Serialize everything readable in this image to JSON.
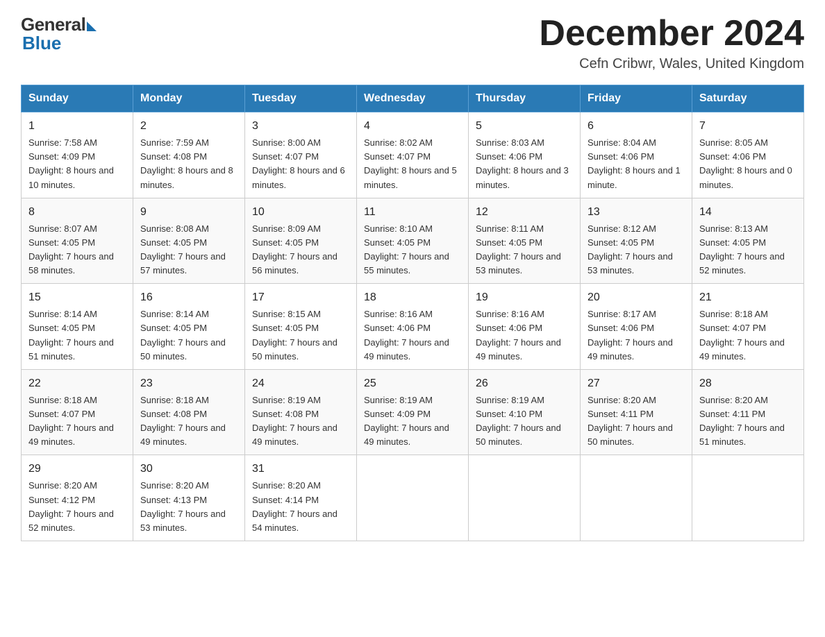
{
  "header": {
    "logo_general": "General",
    "logo_blue": "Blue",
    "month_title": "December 2024",
    "location": "Cefn Cribwr, Wales, United Kingdom"
  },
  "weekdays": [
    "Sunday",
    "Monday",
    "Tuesday",
    "Wednesday",
    "Thursday",
    "Friday",
    "Saturday"
  ],
  "weeks": [
    [
      {
        "day": "1",
        "sunrise": "7:58 AM",
        "sunset": "4:09 PM",
        "daylight": "8 hours and 10 minutes."
      },
      {
        "day": "2",
        "sunrise": "7:59 AM",
        "sunset": "4:08 PM",
        "daylight": "8 hours and 8 minutes."
      },
      {
        "day": "3",
        "sunrise": "8:00 AM",
        "sunset": "4:07 PM",
        "daylight": "8 hours and 6 minutes."
      },
      {
        "day": "4",
        "sunrise": "8:02 AM",
        "sunset": "4:07 PM",
        "daylight": "8 hours and 5 minutes."
      },
      {
        "day": "5",
        "sunrise": "8:03 AM",
        "sunset": "4:06 PM",
        "daylight": "8 hours and 3 minutes."
      },
      {
        "day": "6",
        "sunrise": "8:04 AM",
        "sunset": "4:06 PM",
        "daylight": "8 hours and 1 minute."
      },
      {
        "day": "7",
        "sunrise": "8:05 AM",
        "sunset": "4:06 PM",
        "daylight": "8 hours and 0 minutes."
      }
    ],
    [
      {
        "day": "8",
        "sunrise": "8:07 AM",
        "sunset": "4:05 PM",
        "daylight": "7 hours and 58 minutes."
      },
      {
        "day": "9",
        "sunrise": "8:08 AM",
        "sunset": "4:05 PM",
        "daylight": "7 hours and 57 minutes."
      },
      {
        "day": "10",
        "sunrise": "8:09 AM",
        "sunset": "4:05 PM",
        "daylight": "7 hours and 56 minutes."
      },
      {
        "day": "11",
        "sunrise": "8:10 AM",
        "sunset": "4:05 PM",
        "daylight": "7 hours and 55 minutes."
      },
      {
        "day": "12",
        "sunrise": "8:11 AM",
        "sunset": "4:05 PM",
        "daylight": "7 hours and 53 minutes."
      },
      {
        "day": "13",
        "sunrise": "8:12 AM",
        "sunset": "4:05 PM",
        "daylight": "7 hours and 53 minutes."
      },
      {
        "day": "14",
        "sunrise": "8:13 AM",
        "sunset": "4:05 PM",
        "daylight": "7 hours and 52 minutes."
      }
    ],
    [
      {
        "day": "15",
        "sunrise": "8:14 AM",
        "sunset": "4:05 PM",
        "daylight": "7 hours and 51 minutes."
      },
      {
        "day": "16",
        "sunrise": "8:14 AM",
        "sunset": "4:05 PM",
        "daylight": "7 hours and 50 minutes."
      },
      {
        "day": "17",
        "sunrise": "8:15 AM",
        "sunset": "4:05 PM",
        "daylight": "7 hours and 50 minutes."
      },
      {
        "day": "18",
        "sunrise": "8:16 AM",
        "sunset": "4:06 PM",
        "daylight": "7 hours and 49 minutes."
      },
      {
        "day": "19",
        "sunrise": "8:16 AM",
        "sunset": "4:06 PM",
        "daylight": "7 hours and 49 minutes."
      },
      {
        "day": "20",
        "sunrise": "8:17 AM",
        "sunset": "4:06 PM",
        "daylight": "7 hours and 49 minutes."
      },
      {
        "day": "21",
        "sunrise": "8:18 AM",
        "sunset": "4:07 PM",
        "daylight": "7 hours and 49 minutes."
      }
    ],
    [
      {
        "day": "22",
        "sunrise": "8:18 AM",
        "sunset": "4:07 PM",
        "daylight": "7 hours and 49 minutes."
      },
      {
        "day": "23",
        "sunrise": "8:18 AM",
        "sunset": "4:08 PM",
        "daylight": "7 hours and 49 minutes."
      },
      {
        "day": "24",
        "sunrise": "8:19 AM",
        "sunset": "4:08 PM",
        "daylight": "7 hours and 49 minutes."
      },
      {
        "day": "25",
        "sunrise": "8:19 AM",
        "sunset": "4:09 PM",
        "daylight": "7 hours and 49 minutes."
      },
      {
        "day": "26",
        "sunrise": "8:19 AM",
        "sunset": "4:10 PM",
        "daylight": "7 hours and 50 minutes."
      },
      {
        "day": "27",
        "sunrise": "8:20 AM",
        "sunset": "4:11 PM",
        "daylight": "7 hours and 50 minutes."
      },
      {
        "day": "28",
        "sunrise": "8:20 AM",
        "sunset": "4:11 PM",
        "daylight": "7 hours and 51 minutes."
      }
    ],
    [
      {
        "day": "29",
        "sunrise": "8:20 AM",
        "sunset": "4:12 PM",
        "daylight": "7 hours and 52 minutes."
      },
      {
        "day": "30",
        "sunrise": "8:20 AM",
        "sunset": "4:13 PM",
        "daylight": "7 hours and 53 minutes."
      },
      {
        "day": "31",
        "sunrise": "8:20 AM",
        "sunset": "4:14 PM",
        "daylight": "7 hours and 54 minutes."
      },
      null,
      null,
      null,
      null
    ]
  ],
  "labels": {
    "sunrise": "Sunrise:",
    "sunset": "Sunset:",
    "daylight": "Daylight:"
  }
}
